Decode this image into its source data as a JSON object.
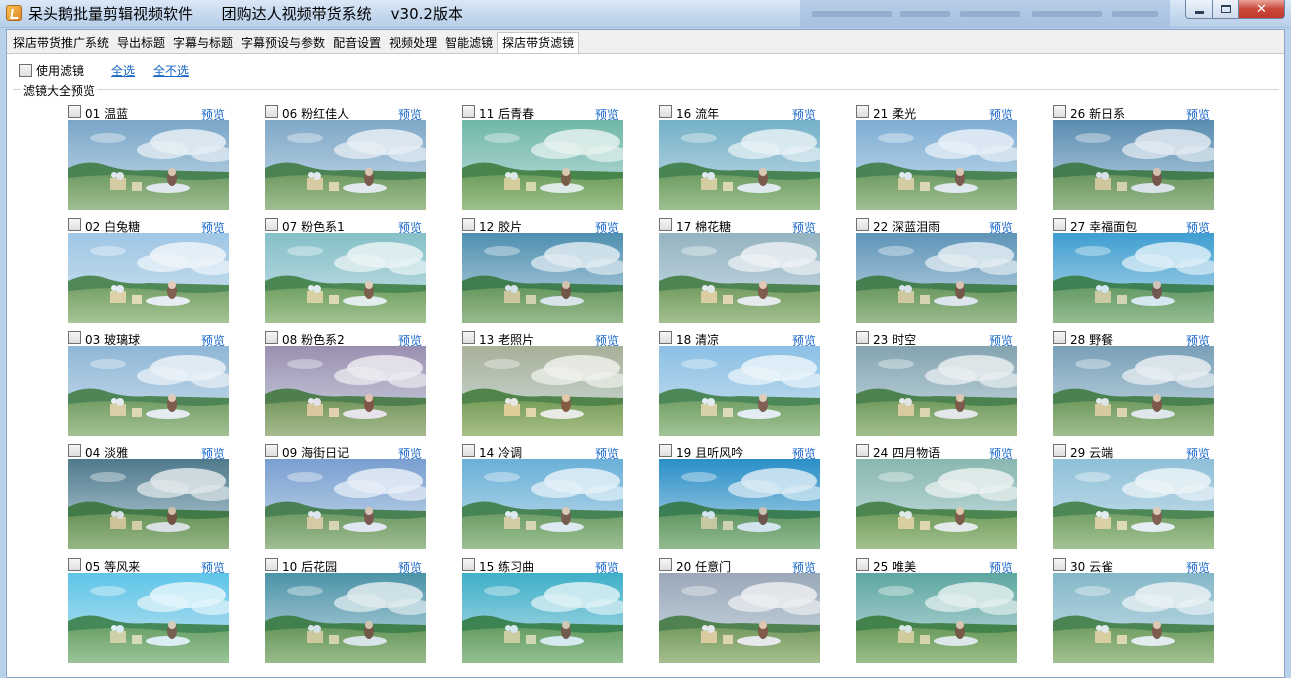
{
  "window": {
    "title": "呆头鹅批量剪辑视频软件      团购达人视频带货系统    v30.2版本",
    "close_glyph": "✕"
  },
  "tabs": [
    {
      "label": "探店带货推广系统",
      "active": false
    },
    {
      "label": "导出标题",
      "active": false
    },
    {
      "label": "字幕与标题",
      "active": false
    },
    {
      "label": "字幕预设与参数",
      "active": false
    },
    {
      "label": "配音设置",
      "active": false
    },
    {
      "label": "视频处理",
      "active": false
    },
    {
      "label": "智能滤镜",
      "active": false
    },
    {
      "label": "探店带货滤镜",
      "active": true
    }
  ],
  "toolbar": {
    "use_filter_label": "使用滤镜",
    "use_filter_checked": false,
    "select_all": "全选",
    "select_none": "全不选"
  },
  "group": {
    "legend": "滤镜大全预览"
  },
  "preview_label": "预览",
  "filters": [
    {
      "label": "01 温蓝",
      "tint": "#7aa6c9"
    },
    {
      "label": "02 白兔糖",
      "tint": "#9fc7e6"
    },
    {
      "label": "03 玻璃球",
      "tint": "#8fb7d6"
    },
    {
      "label": "04 淡雅",
      "tint": "#4f7a8c"
    },
    {
      "label": "05 等风来",
      "tint": "#5fc5e8"
    },
    {
      "label": "06 粉红佳人",
      "tint": "#7fa8c8"
    },
    {
      "label": "07 粉色系1",
      "tint": "#86c0c8"
    },
    {
      "label": "08 粉色系2",
      "tint": "#9b8fb0"
    },
    {
      "label": "09 海街日记",
      "tint": "#7a9fd0"
    },
    {
      "label": "10 后花园",
      "tint": "#4d93a8"
    },
    {
      "label": "11 后青春",
      "tint": "#6fb8a8"
    },
    {
      "label": "12 胶片",
      "tint": "#4f8fb0"
    },
    {
      "label": "13 老照片",
      "tint": "#a8b098"
    },
    {
      "label": "14 冷调",
      "tint": "#6ab0d8"
    },
    {
      "label": "15 练习曲",
      "tint": "#3fb0c8"
    },
    {
      "label": "16 流年",
      "tint": "#74b0c8"
    },
    {
      "label": "17 棉花糖",
      "tint": "#94b4c0"
    },
    {
      "label": "18 清凉",
      "tint": "#8cc0e6"
    },
    {
      "label": "19 且听风吟",
      "tint": "#2a8fc8"
    },
    {
      "label": "20 任意门",
      "tint": "#9aa8b8"
    },
    {
      "label": "21 柔光",
      "tint": "#7eaed4"
    },
    {
      "label": "22 深蓝泪雨",
      "tint": "#5f94b8"
    },
    {
      "label": "23 时空",
      "tint": "#84a4b0"
    },
    {
      "label": "24 四月物语",
      "tint": "#88b8b0"
    },
    {
      "label": "25 唯美",
      "tint": "#5ea8a0"
    },
    {
      "label": "26 新日系",
      "tint": "#5a8cb0"
    },
    {
      "label": "27 幸福面包",
      "tint": "#3f9ed0"
    },
    {
      "label": "28 野餐",
      "tint": "#7aa0b8"
    },
    {
      "label": "29 云端",
      "tint": "#8fc0d8"
    },
    {
      "label": "30 云雀",
      "tint": "#84b8c8"
    }
  ]
}
